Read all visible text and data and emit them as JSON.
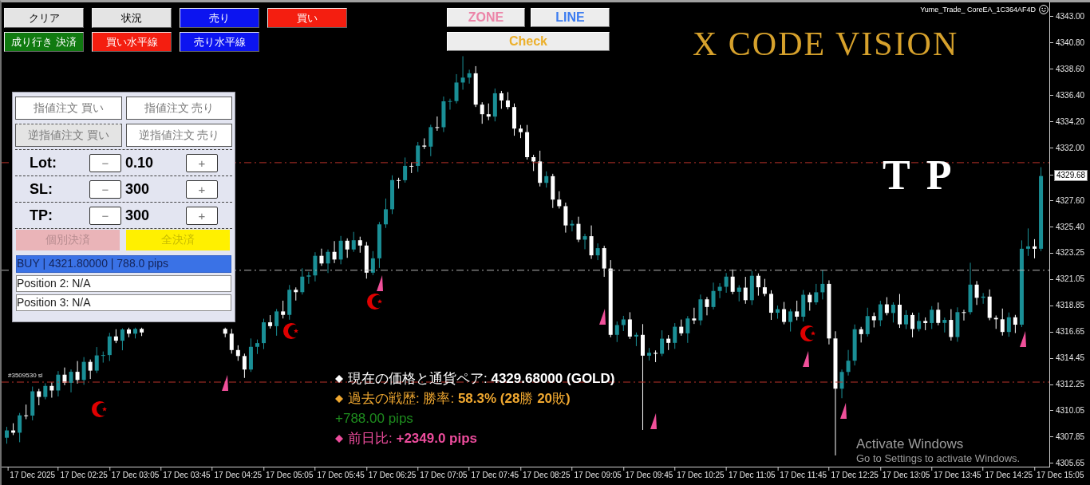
{
  "trade_buttons": [
    [
      {
        "label": "クリア",
        "color": "#e4e4e4"
      },
      {
        "label": "状況",
        "color": "#e4e4e4"
      },
      {
        "label": "売り",
        "color": "#0c14f0"
      },
      {
        "label": "買い",
        "color": "#f41e10"
      }
    ],
    [
      {
        "label": "成り行き 決済",
        "color": "#107a10"
      },
      {
        "label": "買い水平線",
        "color": "#f41e10"
      },
      {
        "label": "売り水平線",
        "color": "#0c14f0"
      }
    ]
  ],
  "tool_buttons": [
    {
      "label": "ZONE",
      "color": "#ec84a8"
    },
    {
      "label": "LINE",
      "color": "#3c7cf0"
    },
    {
      "label": "Check",
      "color": "#ecb02c"
    }
  ],
  "ea_name": "Yume_Trade_ CoreEA_1C364AF4D",
  "brand": "X CODE VISION",
  "order_panel": {
    "order_buttons": [
      {
        "label": "指値注文 買い",
        "pressed": false
      },
      {
        "label": "指値注文 売り",
        "pressed": false
      },
      {
        "label": "逆指値注文 買い",
        "pressed": true
      },
      {
        "label": "逆指値注文 売り",
        "pressed": false
      }
    ],
    "settings": [
      {
        "label": "Lot:",
        "minus": "−",
        "value": "0.10",
        "plus": "+"
      },
      {
        "label": "SL:",
        "minus": "−",
        "value": "300",
        "plus": "+"
      },
      {
        "label": "TP:",
        "minus": "−",
        "value": "300",
        "plus": "+"
      }
    ],
    "close_buttons": [
      {
        "label": "個別決済",
        "color": "#eab4b8"
      },
      {
        "label": "全決済",
        "color": "#fff000"
      }
    ],
    "positions": [
      {
        "text": "BUY | 4321.80000 | 788.0 pips",
        "selected": true
      },
      {
        "text": "Position 2: N/A",
        "selected": false
      },
      {
        "text": "Position 3: N/A",
        "selected": false
      }
    ]
  },
  "chart": {
    "tp_mark": "T P",
    "current_price": "4329.68",
    "chart_data": {
      "type": "candlestick",
      "ylim": [
        4305.38,
        4344.2
      ],
      "categories": [
        null,
        null,
        null,
        null,
        "17 Dec 2025",
        null,
        null,
        null,
        null,
        null,
        null,
        null,
        "17 Dec 02:25",
        null,
        null,
        null,
        null,
        null,
        null,
        null,
        "17 Dec 03:05",
        null,
        null,
        null,
        null,
        null,
        null,
        null,
        "17 Dec 03:45",
        null,
        null,
        null,
        null,
        null,
        null,
        null,
        "17 Dec 04:25",
        null,
        null,
        null,
        null,
        null,
        null,
        null,
        "17 Dec 05:05",
        null,
        null,
        null,
        null,
        null,
        null,
        null,
        "17 Dec 05:45",
        null,
        null,
        null,
        null,
        null,
        null,
        null,
        "17 Dec 06:25",
        null,
        null,
        null,
        null,
        null,
        null,
        null,
        "17 Dec 07:05",
        null,
        null,
        null,
        null,
        null,
        null,
        null,
        "17 Dec 07:45",
        null,
        null,
        null,
        null,
        null,
        null,
        null,
        "17 Dec 08:25",
        null,
        null,
        null,
        null,
        null,
        null,
        null,
        "17 Dec 09:05",
        null,
        null,
        null,
        null,
        null,
        null,
        null,
        "17 Dec 09:45",
        null,
        null,
        null,
        null,
        null,
        null,
        null,
        "17 Dec 10:25",
        null,
        null,
        null,
        null,
        null,
        null,
        null,
        "17 Dec 11:05",
        null,
        null,
        null,
        null,
        null,
        null,
        null,
        "17 Dec 11:45",
        null,
        null,
        null,
        null,
        null,
        null,
        null,
        "17 Dec 12:25",
        null,
        null,
        null,
        null,
        null,
        null,
        null,
        "17 Dec 13:05",
        null,
        null,
        null,
        null,
        null,
        null,
        null,
        "17 Dec 13:45",
        null,
        null,
        null,
        null,
        null,
        null,
        null,
        "17 Dec 14:25",
        null,
        null,
        null,
        null,
        null,
        null,
        null,
        "17 Dec 15:05"
      ],
      "ohlc": [
        [
          4307.8,
          4308.71,
          4307.3,
          4308.41
        ],
        [
          4308.41,
          4309.01,
          4308.02,
          4308.22
        ],
        [
          4308.22,
          4309.87,
          4307.42,
          4309.67
        ],
        [
          4309.67,
          4310.57,
          4309.35,
          4309.65
        ],
        [
          4309.65,
          4312.08,
          4309.25,
          4311.68
        ],
        [
          4311.68,
          4311.88,
          4310.51,
          4311.21
        ],
        [
          4311.21,
          4312.35,
          4311.01,
          4312.13
        ],
        [
          4312.13,
          4312.43,
          4311.15,
          4311.75
        ],
        [
          4311.75,
          4313.37,
          4311.25,
          4313.07
        ],
        [
          4313.07,
          4313.67,
          4312.19,
          4312.39
        ],
        [
          4312.39,
          4313.51,
          4311.59,
          4313.31
        ],
        [
          4313.31,
          4314.21,
          4312.33,
          4312.63
        ],
        [
          4312.63,
          4314.54,
          4312.23,
          4314.14
        ],
        [
          4314.14,
          4314.34,
          4312.71,
          4313.41
        ],
        [
          4313.41,
          4315.38,
          4313.21,
          4314.68
        ],
        [
          4314.68,
          4315.01,
          4314.08,
          4314.71
        ],
        [
          4314.71,
          4316.57,
          4314.21,
          4316.27
        ],
        [
          4316.27,
          4316.87,
          4315.71,
          4315.91
        ],
        [
          4315.91,
          4316.95,
          4315.11,
          4316.85
        ],
        [
          4316.85,
          4317.0,
          4316.2,
          4316.5
        ],
        [
          4316.5,
          4317.0,
          4316.1,
          4316.9
        ],
        [
          4316.9,
          4317.0,
          4316.3,
          4316.6
        ],
        null,
        null,
        null,
        null,
        null,
        null,
        null,
        null,
        null,
        null,
        null,
        null,
        [
          4316.9,
          4317.0,
          4316.2,
          4316.5
        ],
        [
          4316.5,
          4316.9,
          4314.83,
          4315.13
        ],
        [
          4315.13,
          4315.53,
          4314.23,
          4314.63
        ],
        [
          4314.63,
          4314.83,
          4312.8,
          4313.5
        ],
        [
          4313.5,
          4316.1,
          4313.3,
          4315.4
        ],
        [
          4315.4,
          4316.01,
          4314.8,
          4315.71
        ],
        [
          4315.71,
          4317.75,
          4315.21,
          4317.45
        ],
        [
          4317.45,
          4318.05,
          4316.93,
          4317.13
        ],
        [
          4317.13,
          4318.56,
          4316.33,
          4318.36
        ],
        [
          4318.36,
          4319.26,
          4317.77,
          4318.07
        ],
        [
          4318.07,
          4320.57,
          4317.67,
          4320.17
        ],
        [
          4320.17,
          4320.37,
          4319.27,
          4319.97
        ],
        [
          4319.97,
          4321.97,
          4319.77,
          4321.27
        ],
        [
          4321.27,
          4321.67,
          4320.67,
          4321.37
        ],
        [
          4321.37,
          4323.31,
          4320.87,
          4323.01
        ],
        [
          4323.01,
          4323.61,
          4322.17,
          4322.37
        ],
        [
          4322.37,
          4323.54,
          4321.57,
          4323.34
        ],
        [
          4323.34,
          4324.24,
          4322.4,
          4322.7
        ],
        [
          4322.7,
          4324.67,
          4322.3,
          4324.27
        ],
        [
          4324.27,
          4324.47,
          4322.84,
          4323.54
        ],
        [
          4323.54,
          4325.01,
          4323.34,
          4324.31
        ],
        [
          4324.31,
          4324.61,
          4323.27,
          4323.87
        ],
        [
          4323.87,
          4324.17,
          4321.1,
          4321.6
        ],
        [
          4321.6,
          4323.4,
          4321.4,
          4322.8
        ],
        [
          4322.8,
          4325.84,
          4322.0,
          4325.64
        ],
        [
          4325.64,
          4327.8,
          4325.34,
          4326.9
        ],
        [
          4326.9,
          4329.74,
          4326.5,
          4329.34
        ],
        [
          4329.34,
          4329.54,
          4328.63,
          4329.33
        ],
        [
          4329.33,
          4331.23,
          4329.13,
          4330.53
        ],
        [
          4330.53,
          4330.83,
          4329.93,
          4330.53
        ],
        [
          4330.53,
          4332.53,
          4330.03,
          4332.23
        ],
        [
          4332.23,
          4332.83,
          4331.94,
          4332.14
        ],
        [
          4332.14,
          4333.97,
          4331.34,
          4333.77
        ],
        [
          4333.77,
          4334.66,
          4333.46,
          4333.76
        ],
        [
          4333.76,
          4336.33,
          4333.36,
          4335.93
        ],
        [
          4335.93,
          4336.15,
          4335.23,
          4335.95
        ],
        [
          4335.95,
          4338.2,
          4335.75,
          4337.5
        ],
        [
          4337.5,
          4339.7,
          4336.9,
          4337.91
        ],
        [
          4337.91,
          4338.57,
          4337.41,
          4338.27
        ],
        [
          4338.27,
          4338.87,
          4335.45,
          4335.65
        ],
        [
          4335.65,
          4335.85,
          4334.05,
          4334.85
        ],
        [
          4334.85,
          4335.75,
          4334.35,
          4334.65
        ],
        [
          4334.65,
          4337.0,
          4334.25,
          4336.6
        ],
        [
          4336.6,
          4336.8,
          4335.3,
          4336.0
        ],
        [
          4336.0,
          4336.7,
          4335.25,
          4335.45
        ],
        [
          4335.45,
          4335.75,
          4333.05,
          4333.65
        ],
        [
          4333.65,
          4333.95,
          4332.85,
          4333.35
        ],
        [
          4333.35,
          4333.95,
          4331.06,
          4331.26
        ],
        [
          4331.26,
          4331.46,
          4330.1,
          4330.9
        ],
        [
          4330.9,
          4331.8,
          4328.81,
          4329.11
        ],
        [
          4329.11,
          4330.07,
          4328.71,
          4329.67
        ],
        [
          4329.67,
          4329.87,
          4327.01,
          4327.71
        ],
        [
          4327.71,
          4328.41,
          4326.96,
          4327.16
        ],
        [
          4327.16,
          4327.46,
          4324.95,
          4325.55
        ],
        [
          4325.55,
          4325.98,
          4325.05,
          4325.68
        ],
        [
          4325.68,
          4326.28,
          4324.16,
          4324.36
        ],
        [
          4324.36,
          4324.85,
          4323.56,
          4324.65
        ],
        [
          4324.65,
          4325.55,
          4322.75,
          4323.05
        ],
        [
          4323.05,
          4324.05,
          4322.65,
          4323.65
        ],
        [
          4323.65,
          4323.85,
          4321.25,
          4321.95
        ],
        [
          4321.95,
          4322.65,
          4316.2,
          4316.4
        ],
        [
          4316.4,
          4317.52,
          4315.8,
          4317.22
        ],
        [
          4317.22,
          4317.99,
          4316.72,
          4317.69
        ],
        [
          4317.69,
          4318.29,
          4316.06,
          4316.26
        ],
        [
          4316.26,
          4316.6,
          4315.46,
          4316.4
        ],
        [
          4316.4,
          4317.3,
          4308.45,
          4314.66
        ],
        [
          4314.66,
          4315.3,
          4314.26,
          4314.9
        ],
        [
          4314.9,
          4315.1,
          4314.12,
          4314.82
        ],
        [
          4314.82,
          4316.78,
          4314.62,
          4316.08
        ],
        [
          4316.08,
          4316.38,
          4315.13,
          4315.73
        ],
        [
          4315.73,
          4317.38,
          4315.23,
          4317.08
        ],
        [
          4317.08,
          4317.68,
          4316.33,
          4316.53
        ],
        [
          4316.53,
          4317.97,
          4315.73,
          4317.77
        ],
        [
          4317.77,
          4318.67,
          4317.31,
          4317.61
        ],
        [
          4317.61,
          4319.77,
          4317.21,
          4319.37
        ],
        [
          4319.37,
          4319.57,
          4318.03,
          4318.73
        ],
        [
          4318.73,
          4320.77,
          4318.53,
          4320.07
        ],
        [
          4320.07,
          4320.72,
          4319.47,
          4320.42
        ],
        [
          4320.42,
          4321.57,
          4319.92,
          4321.27
        ],
        [
          4321.27,
          4321.87,
          4319.8,
          4320.0
        ],
        [
          4320.0,
          4320.55,
          4319.2,
          4320.35
        ],
        [
          4320.35,
          4321.25,
          4319.0,
          4319.3
        ],
        [
          4319.3,
          4321.74,
          4318.9,
          4321.34
        ],
        [
          4321.34,
          4321.54,
          4319.68,
          4320.38
        ],
        [
          4320.38,
          4321.08,
          4319.63,
          4319.83
        ],
        [
          4319.83,
          4320.13,
          4317.65,
          4318.25
        ],
        [
          4318.25,
          4318.85,
          4317.75,
          4318.55
        ],
        [
          4318.55,
          4319.15,
          4317.28,
          4317.48
        ],
        [
          4317.48,
          4318.56,
          4316.68,
          4318.36
        ],
        [
          4318.36,
          4319.26,
          4317.62,
          4317.92
        ],
        [
          4317.92,
          4320.15,
          4317.52,
          4319.75
        ],
        [
          4319.75,
          4319.95,
          4318.42,
          4319.12
        ],
        [
          4319.12,
          4320.66,
          4318.92,
          4319.96
        ],
        [
          4319.96,
          4321.8,
          4319.36,
          4320.66
        ],
        [
          4320.66,
          4320.96,
          4315.6,
          4316.1
        ],
        [
          4316.1,
          4316.7,
          4306.32,
          4311.9
        ],
        [
          4311.9,
          4313.5,
          4311.1,
          4313.3
        ],
        [
          4313.3,
          4315.14,
          4313.0,
          4314.24
        ],
        [
          4314.24,
          4317.27,
          4313.84,
          4316.87
        ],
        [
          4316.87,
          4317.07,
          4315.76,
          4316.46
        ],
        [
          4316.46,
          4318.67,
          4316.26,
          4317.97
        ],
        [
          4317.97,
          4318.27,
          4317.02,
          4317.62
        ],
        [
          4317.62,
          4319.25,
          4317.12,
          4318.95
        ],
        [
          4318.95,
          4319.55,
          4318.03,
          4318.23
        ],
        [
          4318.23,
          4319.12,
          4317.43,
          4318.92
        ],
        [
          4318.92,
          4319.82,
          4316.98,
          4317.28
        ],
        [
          4317.28,
          4318.46,
          4316.88,
          4318.06
        ],
        [
          4318.06,
          4318.26,
          4316.19,
          4316.89
        ],
        [
          4316.89,
          4318.26,
          4316.69,
          4317.56
        ],
        [
          4317.56,
          4317.86,
          4316.79,
          4317.39
        ],
        [
          4317.39,
          4318.8,
          4316.89,
          4318.5
        ],
        [
          4318.5,
          4319.1,
          4317.2,
          4317.4
        ],
        [
          4317.4,
          4317.85,
          4316.6,
          4317.65
        ],
        [
          4317.65,
          4318.55,
          4315.92,
          4316.22
        ],
        [
          4316.22,
          4318.7,
          4315.82,
          4318.3
        ],
        [
          4318.3,
          4318.5,
          4317.6,
          4318.3
        ],
        [
          4318.3,
          4322.43,
          4318.1,
          4320.6
        ],
        [
          4320.6,
          4320.9,
          4318.9,
          4319.5
        ],
        [
          4319.5,
          4319.9,
          4319.0,
          4319.6
        ],
        [
          4319.6,
          4320.2,
          4317.62,
          4317.82
        ],
        [
          4317.82,
          4318.02,
          4316.9,
          4317.7
        ],
        [
          4317.7,
          4318.6,
          4316.34,
          4316.64
        ],
        [
          4316.64,
          4318.27,
          4316.24,
          4317.87
        ],
        [
          4317.87,
          4318.07,
          4316.55,
          4317.25
        ],
        [
          4317.25,
          4324.3,
          4317.05,
          4323.6
        ],
        [
          4323.6,
          4325.3,
          4323.0,
          4323.8
        ],
        [
          4323.8,
          4324.4,
          4322.8,
          4323.6
        ],
        [
          4323.6,
          4330.42,
          4323.4,
          4329.68
        ],
        null,
        null,
        null
      ],
      "ref_lines": [
        {
          "axis": "y",
          "value": 4330.8,
          "color": "#b8322a"
        },
        {
          "axis": "y",
          "value": 4321.8,
          "color": "#b4b4b4"
        },
        {
          "axis": "y",
          "value": 4312.45,
          "color": "#b8322a",
          "label": "#3509530 sl"
        }
      ],
      "yticks": [
        {
          "value": 4343.0,
          "label": "4343.00"
        },
        {
          "value": 4340.8,
          "label": "4340.80"
        },
        {
          "value": 4338.6,
          "label": "4338.60"
        },
        {
          "value": 4336.4,
          "label": "4336.40"
        },
        {
          "value": 4334.2,
          "label": "4334.20"
        },
        {
          "value": 4332.0,
          "label": "4332.00"
        },
        {
          "value": 4327.6,
          "label": "4327.60"
        },
        {
          "value": 4325.4,
          "label": "4325.40"
        },
        {
          "value": 4323.25,
          "label": "4323.25"
        },
        {
          "value": 4321.05,
          "label": "4321.05"
        },
        {
          "value": 4318.85,
          "label": "4318.85"
        },
        {
          "value": 4316.65,
          "label": "4316.65"
        },
        {
          "value": 4314.45,
          "label": "4314.45"
        },
        {
          "value": 4312.25,
          "label": "4312.25"
        },
        {
          "value": 4310.05,
          "label": "4310.05"
        },
        {
          "value": 4307.85,
          "label": "4307.85"
        },
        {
          "value": 4305.65,
          "label": "4305.65"
        }
      ]
    }
  },
  "info": [
    {
      "kind": "bullet",
      "color": "#ffffff",
      "text": "現在の価格と通貨ペア: **4329.68000 (GOLD)**"
    },
    {
      "kind": "bullet",
      "color": "#f0a830",
      "text": "過去の戦歴: 勝率: **58.3% (28**勝 **20**敗**)**"
    },
    {
      "kind": "plain",
      "color": "#1e8c1e",
      "text": "+788.00 pips"
    },
    {
      "kind": "bullet",
      "color": "#ec4c9c",
      "text": "前日比: **+2349.0 pips**"
    }
  ],
  "os_notice": {
    "title": "Activate Windows",
    "text": "Go to Settings to activate Windows."
  }
}
